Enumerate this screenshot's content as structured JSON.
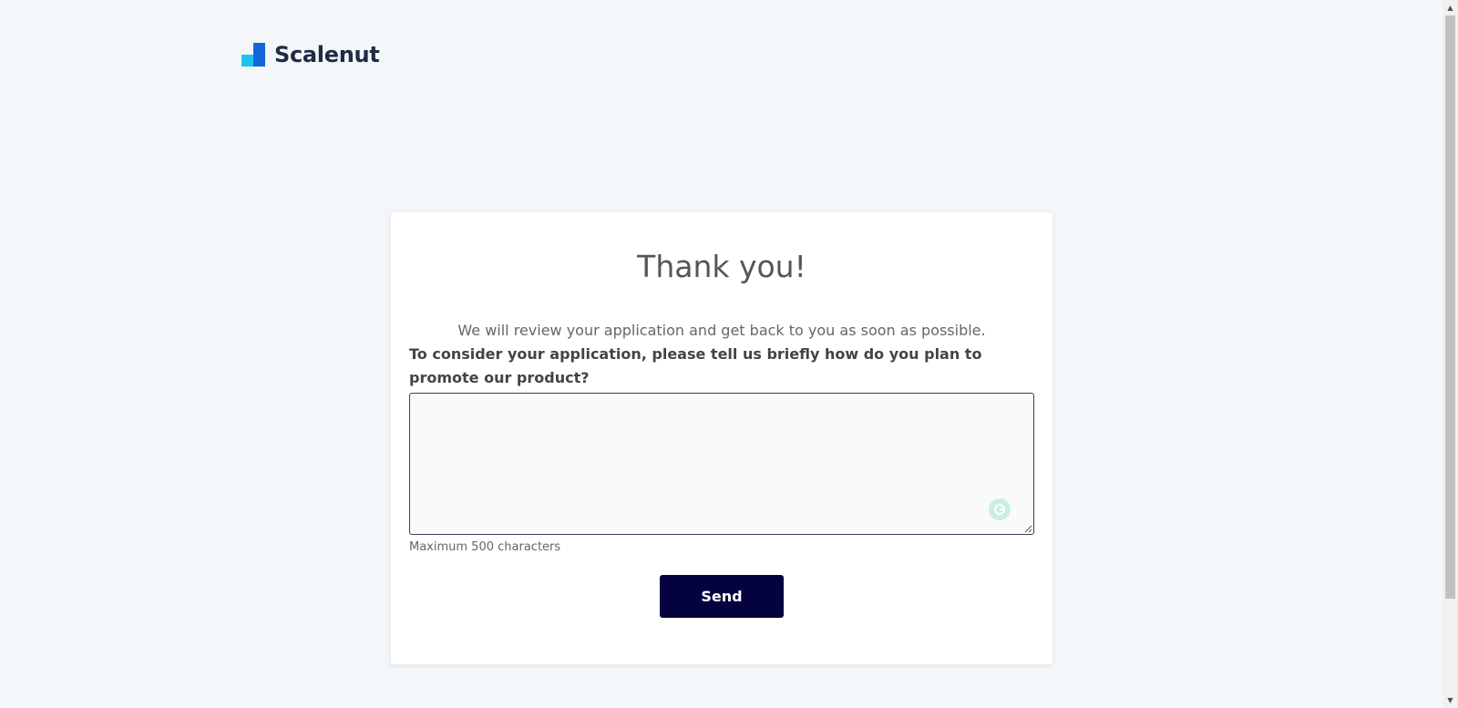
{
  "brand": {
    "name": "Scalenut",
    "colors": {
      "mark_dark": "#1565d8",
      "mark_light": "#1fc1f1",
      "text": "#1f2a44"
    }
  },
  "card": {
    "title": "Thank you!",
    "subtitle": "We will review your application and get back to you as soon as possible.",
    "question": "To consider your application, please tell us briefly how do you plan to promote our product?",
    "textarea": {
      "value": "",
      "placeholder": ""
    },
    "hint": "Maximum 500 characters",
    "send_label": "Send",
    "send_color": "#05033f"
  },
  "icons": {
    "grammarly": "grammarly-icon",
    "resize": "resize-handle-icon"
  },
  "scrollbar": {
    "up_arrow": "▲",
    "down_arrow": "▼"
  }
}
